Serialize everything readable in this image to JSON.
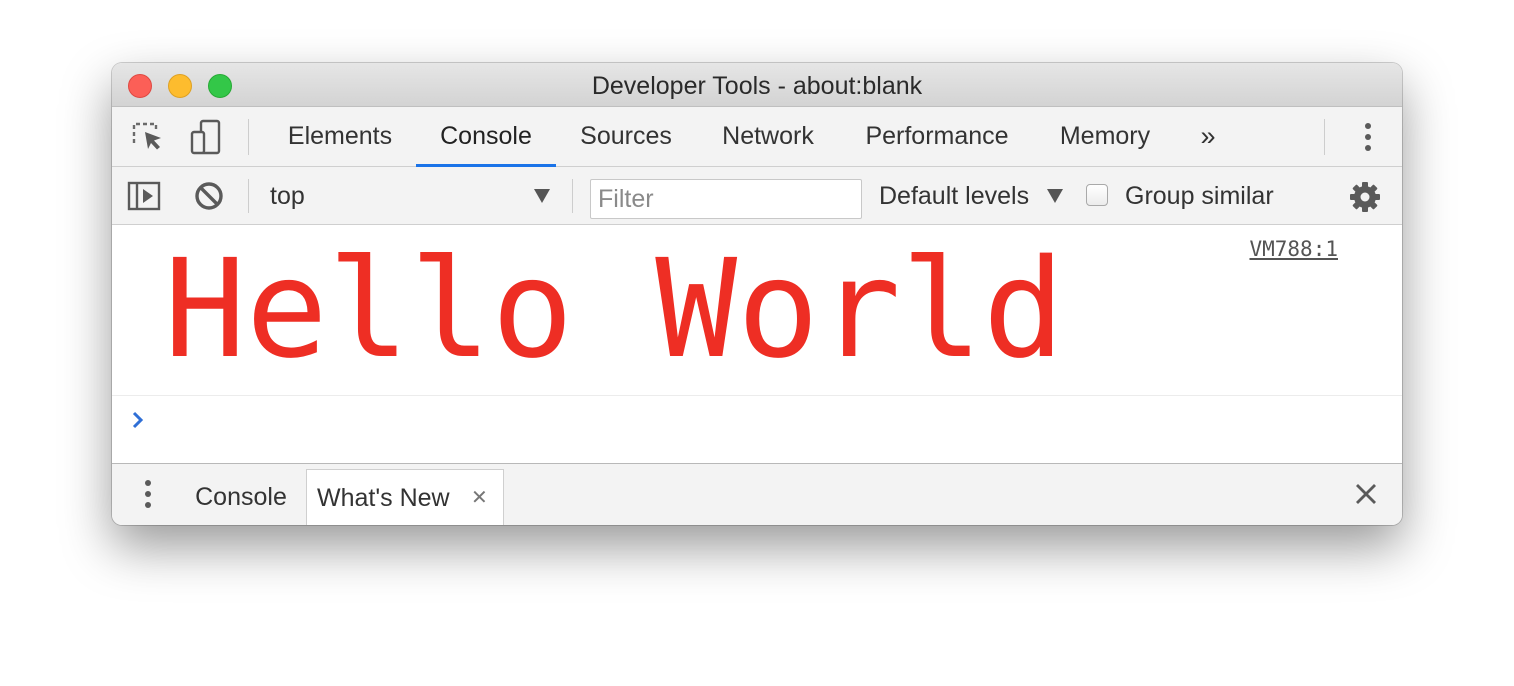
{
  "window": {
    "title": "Developer Tools - about:blank"
  },
  "main_toolbar": {
    "icons": [
      "inspect-element-icon",
      "device-toolbar-icon",
      "more-tabs-icon",
      "customize-menu-icon"
    ],
    "tabs": [
      {
        "label": "Elements",
        "active": false
      },
      {
        "label": "Console",
        "active": true
      },
      {
        "label": "Sources",
        "active": false
      },
      {
        "label": "Network",
        "active": false
      },
      {
        "label": "Performance",
        "active": false
      },
      {
        "label": "Memory",
        "active": false
      }
    ],
    "more_tabs_glyph": "»"
  },
  "console_toolbar": {
    "context": "top",
    "filter": {
      "value": "",
      "placeholder": "Filter"
    },
    "levels_label": "Default levels",
    "group_similar_label": "Group similar",
    "group_similar_checked": false
  },
  "console": {
    "messages": [
      {
        "text": "Hello World",
        "source": "VM788:1",
        "color": "#ee2e24"
      }
    ],
    "prompt_glyph": "›"
  },
  "drawer": {
    "tabs": [
      {
        "label": "Console",
        "active": false
      },
      {
        "label": "What's New",
        "active": true,
        "closable": true
      }
    ],
    "close_glyph": "✕"
  },
  "colors": {
    "accent": "#1a73e8",
    "message_red": "#ee2e24",
    "toolbar_bg": "#f3f3f3"
  }
}
